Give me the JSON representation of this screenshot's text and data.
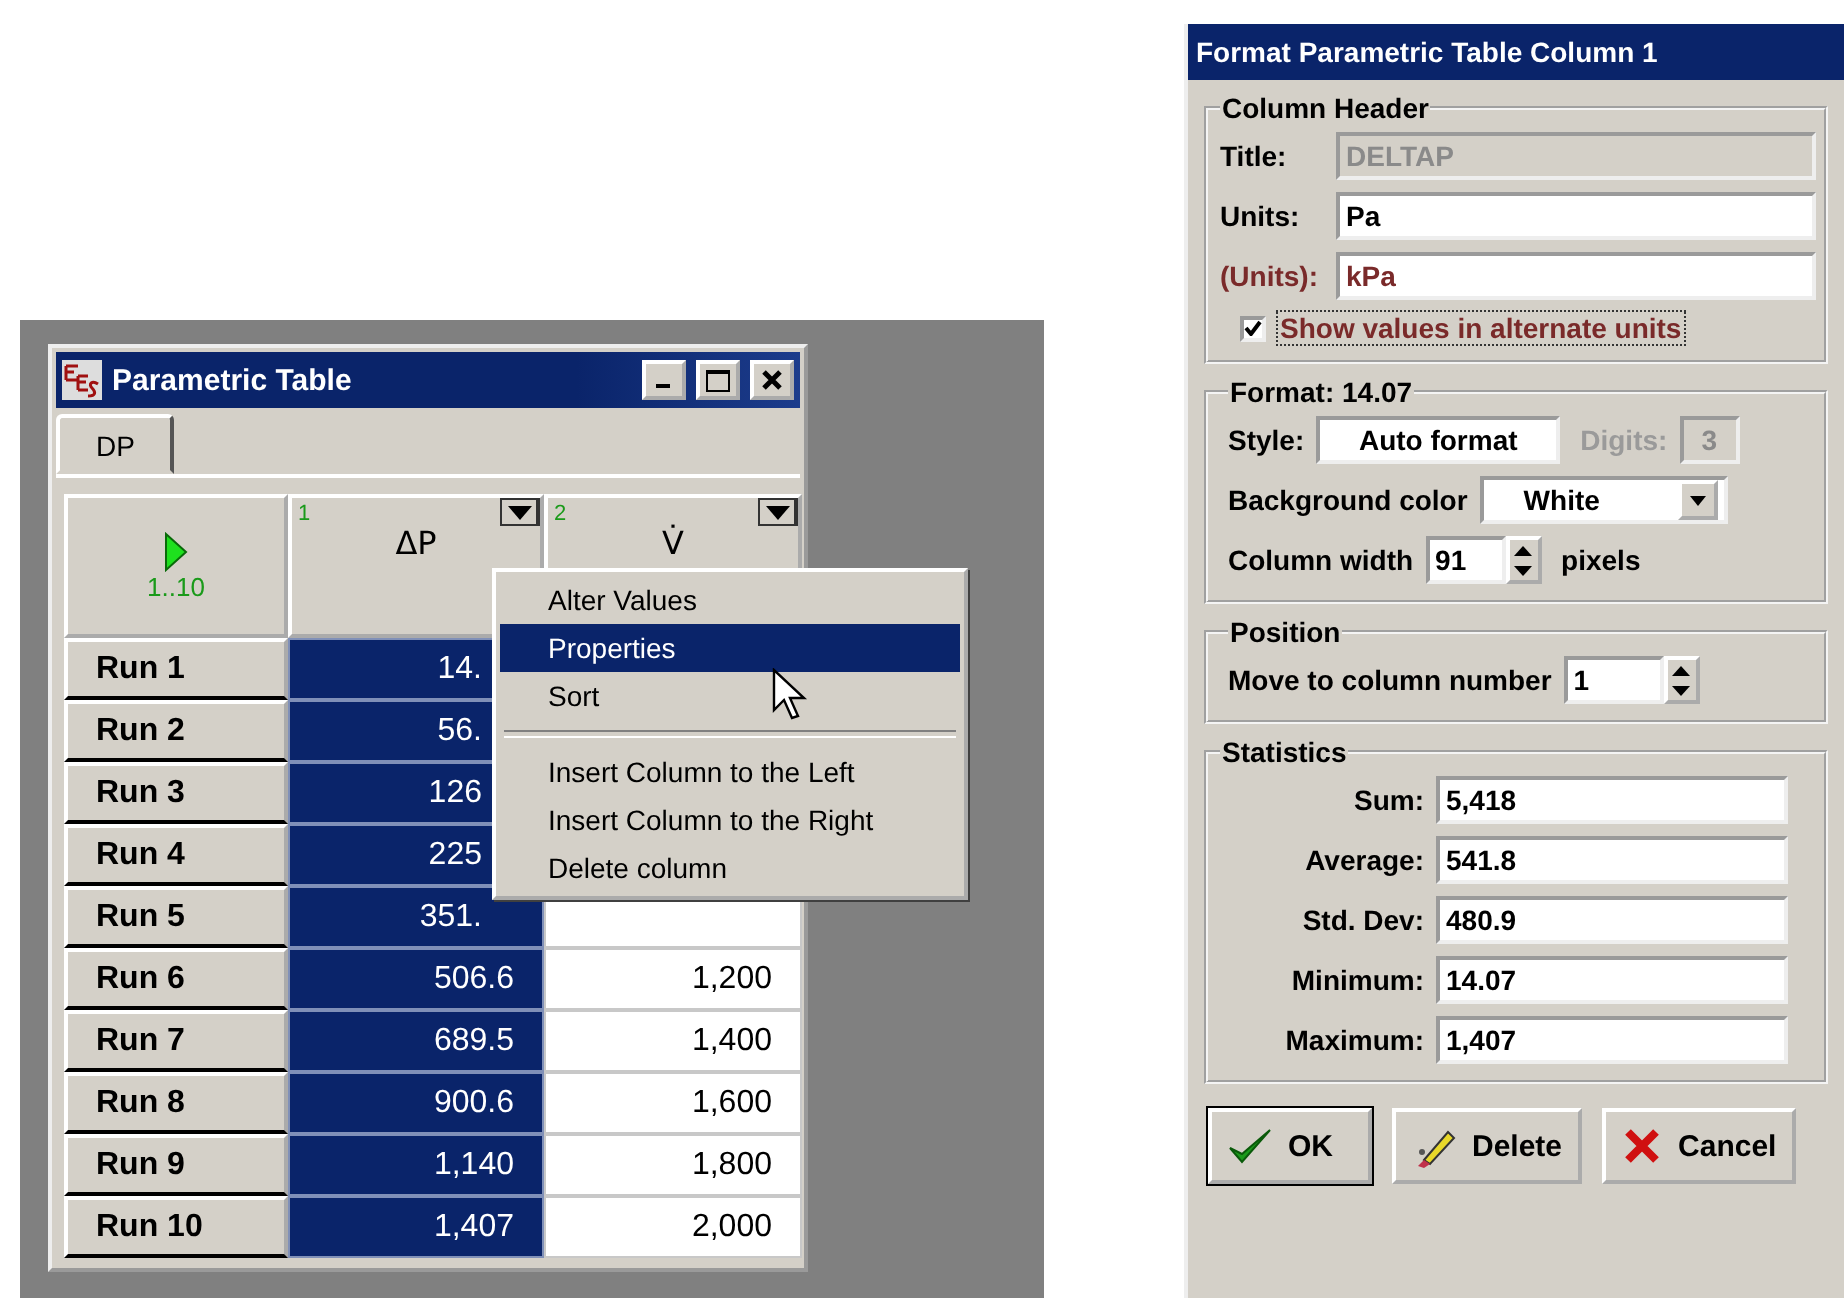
{
  "table_window": {
    "title": "Parametric Table",
    "tabs": [
      {
        "label": "DP",
        "selected": true
      }
    ],
    "run_range": "1..10",
    "columns": [
      {
        "number": "1",
        "name": "ΔP",
        "selected": true
      },
      {
        "number": "2",
        "name": "V̇",
        "selected": false
      }
    ],
    "rows": [
      {
        "label": "Run 1",
        "values": [
          "14."
        ]
      },
      {
        "label": "Run 2",
        "values": [
          "56."
        ]
      },
      {
        "label": "Run 3",
        "values": [
          "126"
        ]
      },
      {
        "label": "Run 4",
        "values": [
          "225"
        ]
      },
      {
        "label": "Run 5",
        "values": [
          "351."
        ]
      },
      {
        "label": "Run 6",
        "values": [
          "506.6",
          "1,200"
        ]
      },
      {
        "label": "Run 7",
        "values": [
          "689.5",
          "1,400"
        ]
      },
      {
        "label": "Run 8",
        "values": [
          "900.6",
          "1,600"
        ]
      },
      {
        "label": "Run 9",
        "values": [
          "1,140",
          "1,800"
        ]
      },
      {
        "label": "Run 10",
        "values": [
          "1,407",
          "2,000"
        ]
      }
    ]
  },
  "context_menu": {
    "items": [
      {
        "kind": "item",
        "label": "Alter Values",
        "selected": false
      },
      {
        "kind": "item",
        "label": "Properties",
        "selected": true
      },
      {
        "kind": "item",
        "label": "Sort",
        "selected": false
      },
      {
        "kind": "separator"
      },
      {
        "kind": "item",
        "label": "Insert Column to the Left",
        "selected": false
      },
      {
        "kind": "item",
        "label": "Insert Column to the Right",
        "selected": false
      },
      {
        "kind": "item",
        "label": "Delete column",
        "selected": false
      }
    ]
  },
  "dialog": {
    "title": "Format Parametric Table Column 1",
    "column_header": {
      "legend": "Column Header",
      "fields": [
        {
          "label": "Title:",
          "value": "DELTAP",
          "disabled": true,
          "alternate": false
        },
        {
          "label": "Units:",
          "value": "Pa",
          "disabled": false,
          "alternate": false
        },
        {
          "label": "(Units):",
          "value": "kPa",
          "disabled": false,
          "alternate": true
        }
      ],
      "checkbox": {
        "label": "Show values in alternate units",
        "checked": true
      }
    },
    "format": {
      "legend": "Format: 14.07",
      "style_label": "Style:",
      "style_value": "Auto format",
      "digits_label": "Digits:",
      "digits_value": "3",
      "digits_disabled": true,
      "background_label": "Background color",
      "background_value": "White",
      "width_label": "Column width",
      "width_value": "91",
      "width_unit": "pixels"
    },
    "position": {
      "legend": "Position",
      "label": "Move to column number",
      "value": "1"
    },
    "statistics": {
      "legend": "Statistics",
      "items": [
        {
          "label": "Sum:",
          "value": "5,418"
        },
        {
          "label": "Average:",
          "value": "541.8"
        },
        {
          "label": "Std. Dev:",
          "value": "480.9"
        },
        {
          "label": "Minimum:",
          "value": "14.07"
        },
        {
          "label": "Maximum:",
          "value": "1,407"
        }
      ]
    },
    "buttons": [
      {
        "kind": "ok",
        "label": "OK"
      },
      {
        "kind": "delete",
        "label": "Delete"
      },
      {
        "kind": "cancel",
        "label": "Cancel"
      }
    ]
  }
}
